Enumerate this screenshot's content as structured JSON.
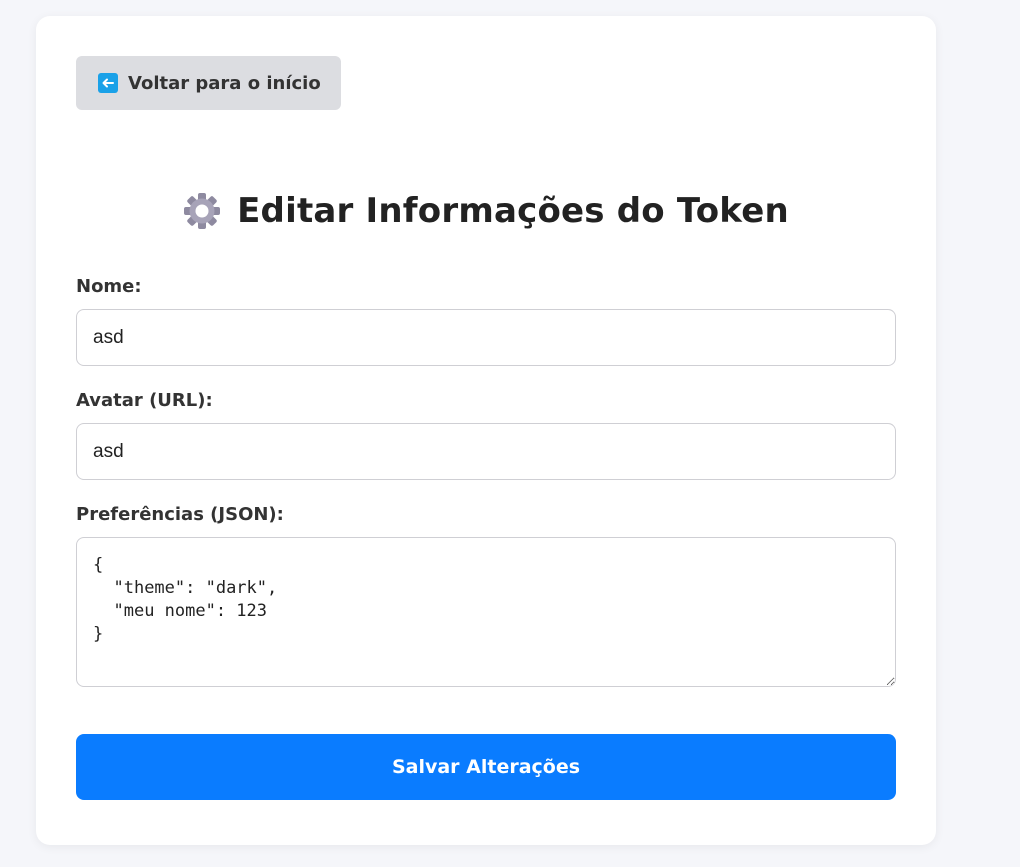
{
  "nav": {
    "back_label": "Voltar para o início",
    "back_icon": "left-arrow-icon"
  },
  "header": {
    "title": "Editar Informações do Token",
    "icon": "gear-icon"
  },
  "form": {
    "name": {
      "label": "Nome:",
      "value": "asd"
    },
    "avatar": {
      "label": "Avatar (URL):",
      "value": "asd"
    },
    "preferences": {
      "label": "Preferências (JSON):",
      "value": "{\n  \"theme\": \"dark\",\n  \"meu nome\": 123\n}"
    },
    "submit_label": "Salvar Alterações"
  },
  "colors": {
    "primary": "#0a7cff",
    "back_button_bg": "#dcdde1",
    "back_icon_bg": "#1aa1e8"
  }
}
